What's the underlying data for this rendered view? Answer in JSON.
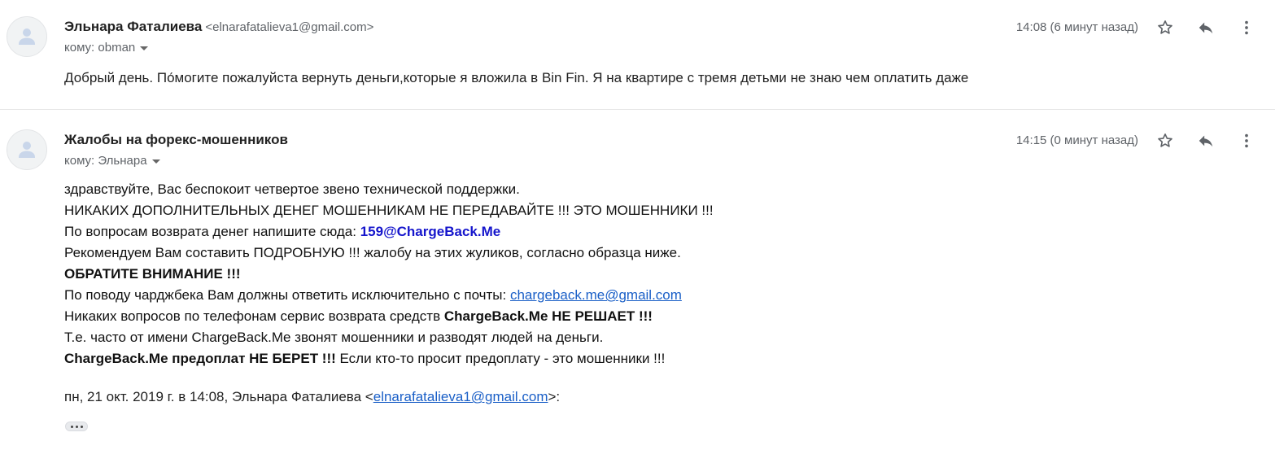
{
  "messages": [
    {
      "sender_name": "Эльнара Фаталиева",
      "sender_email": "<elnarafatalieva1@gmail.com>",
      "to_label": "кому: obman",
      "time": "14:08 (6 минут назад)",
      "body": "Добрый день. По́могите пожалуйста вернуть деньги,которые я вложила в Bin Fin. Я на квартире с тремя  детьми не знаю чем оплатить даже"
    },
    {
      "sender_name": "Жалобы на форекс-мошенников",
      "to_label": "кому: Эльнара",
      "time": "14:15 (0 минут назад)",
      "body": {
        "line1": "здравствуйте, Вас беспокоит четвертое звено технической поддержки.",
        "line2": "НИКАКИХ ДОПОЛНИТЕЛЬНЫХ ДЕНЕГ МОШЕННИКАМ НЕ ПЕРЕДАВАЙТЕ !!! ЭТО МОШЕННИКИ !!!",
        "line3_text": "По вопросам возврата денег напишите сюда: ",
        "line3_bold": "159@ChargeBack.Me",
        "line4": "Рекомендуем Вам составить ПОДРОБНУЮ !!! жалобу на этих жуликов, согласно образца ниже.",
        "line5": "ОБРАТИТЕ ВНИМАНИЕ !!!",
        "line6_text": "По поводу чарджбека Вам должны ответить исключительно с почты: ",
        "line6_link": "chargeback.me@gmail.com",
        "line7_text": "Никаких вопросов по телефонам сервис возврата средств ",
        "line7_bold": "ChargeBack.Me НЕ РЕШАЕТ !!!",
        "line8": "Т.е. часто от имени ChargeBack.Me звонят мошенники и разводят людей на деньги.",
        "line9_bold": "ChargeBack.Me предоплат НЕ БЕРЕТ !!!",
        "line9_text": " Если кто-то просит предоплату - это мошенники !!!"
      },
      "quote": {
        "prefix": "пн, 21 окт. 2019 г. в 14:08, Эльнара Фаталиева <",
        "email": "elnarafatalieva1@gmail.com",
        "suffix": ">:"
      }
    }
  ],
  "icons": {
    "avatar": "person-icon",
    "star": "star-outline-icon",
    "reply": "reply-arrow-icon",
    "more": "vertical-dots-icon",
    "expand": "ellipsis-icon"
  },
  "colors": {
    "link": "#1a5fc7",
    "bold_email": "#1515cc",
    "meta_gray": "#5f6368",
    "avatar_bg": "#f1f3f4",
    "avatar_figure": "#c3d5f0"
  }
}
